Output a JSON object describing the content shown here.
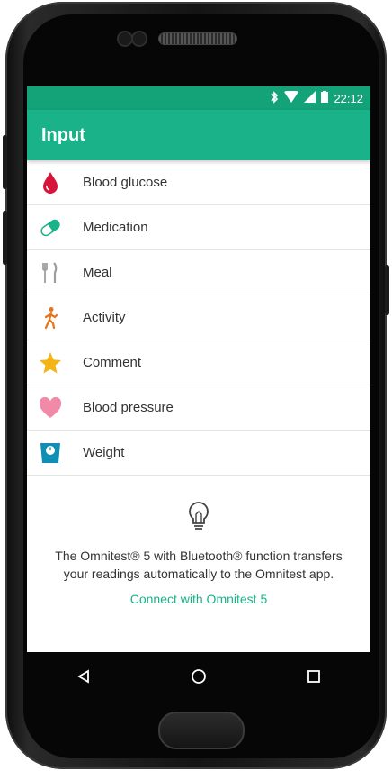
{
  "status_bar": {
    "time": "22:12"
  },
  "app_bar": {
    "title": "Input"
  },
  "list_items": [
    {
      "label": "Blood glucose",
      "icon": "blood-drop-icon",
      "color": "#d8143a"
    },
    {
      "label": "Medication",
      "icon": "pill-icon",
      "color": "#1ab389"
    },
    {
      "label": "Meal",
      "icon": "fork-knife-icon",
      "color": "#9e9e9e"
    },
    {
      "label": "Activity",
      "icon": "walking-person-icon",
      "color": "#e8731b"
    },
    {
      "label": "Comment",
      "icon": "star-icon",
      "color": "#f5b416"
    },
    {
      "label": "Blood pressure",
      "icon": "heart-icon",
      "color": "#f08aa6"
    },
    {
      "label": "Weight",
      "icon": "scale-icon",
      "color": "#0e8fb3"
    }
  ],
  "info": {
    "text": "The Omnitest® 5 with Bluetooth® function transfers your readings automatically to the Omnitest app.",
    "link": "Connect with Omnitest 5"
  },
  "nav": {
    "back_icon": "back-triangle-icon",
    "home_icon": "home-circle-icon",
    "recents_icon": "recents-square-icon"
  },
  "colors": {
    "accent": "#1ab389",
    "status_bar": "#14a279"
  }
}
